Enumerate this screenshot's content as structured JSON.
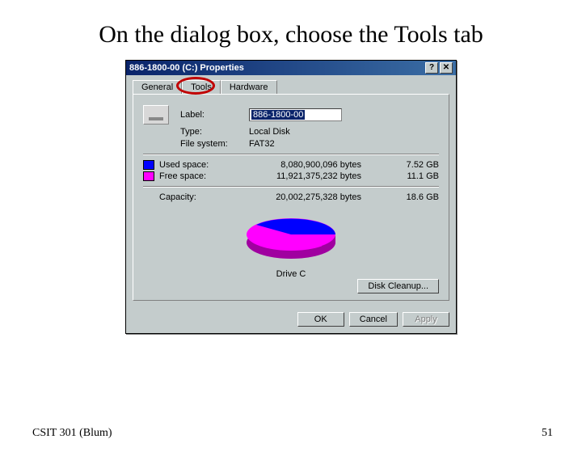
{
  "slide": {
    "title": "On the dialog box, choose the Tools tab",
    "footer_left": "CSIT 301 (Blum)",
    "footer_right": "51"
  },
  "dialog": {
    "title": "886-1800-00 (C:) Properties",
    "help_btn": "?",
    "close_btn": "✕",
    "tabs": {
      "general": "General",
      "tools": "Tools",
      "hardware": "Hardware"
    },
    "label_label": "Label:",
    "label_value": "886-1800-00",
    "type_label": "Type:",
    "type_value": "Local Disk",
    "fs_label": "File system:",
    "fs_value": "FAT32",
    "used_label": "Used space:",
    "used_bytes": "8,080,900,096 bytes",
    "used_human": "7.52 GB",
    "free_label": "Free space:",
    "free_bytes": "11,921,375,232 bytes",
    "free_human": "11.1 GB",
    "capacity_label": "Capacity:",
    "capacity_bytes": "20,002,275,328 bytes",
    "capacity_human": "18.6 GB",
    "drive_label": "Drive C",
    "disk_cleanup": "Disk Cleanup...",
    "ok": "OK",
    "cancel": "Cancel",
    "apply": "Apply"
  },
  "colors": {
    "used": "#0000ff",
    "free": "#ff00ff"
  },
  "chart_data": {
    "type": "pie",
    "title": "Drive C",
    "series": [
      {
        "name": "Used space",
        "value": 8080900096,
        "color": "#0000ff"
      },
      {
        "name": "Free space",
        "value": 11921375232,
        "color": "#ff00ff"
      }
    ]
  }
}
